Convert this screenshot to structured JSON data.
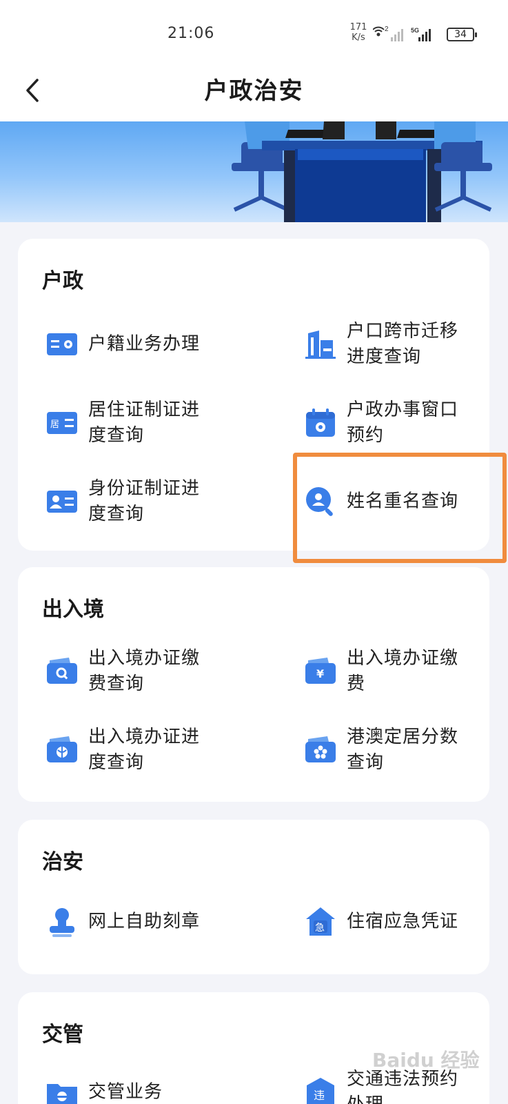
{
  "status_bar": {
    "time": "21:06",
    "net_speed_value": "171",
    "net_speed_unit": "K/s",
    "signal_label": "2",
    "network_type": "5G",
    "battery": "34"
  },
  "nav": {
    "back_icon": "chevron-left-icon",
    "title": "户政治安"
  },
  "sections": [
    {
      "title": "户政",
      "items": [
        {
          "label": "户籍业务办理",
          "icon": "id-card-icon"
        },
        {
          "label": "户口跨市迁移进度查询",
          "icon": "building-icon"
        },
        {
          "label": "居住证制证进度查询",
          "icon": "residence-card-icon"
        },
        {
          "label": "户政办事窗口预约",
          "icon": "calendar-icon"
        },
        {
          "label": "身份证制证进度查询",
          "icon": "identity-card-icon"
        },
        {
          "label": "姓名重名查询",
          "icon": "person-search-icon"
        }
      ]
    },
    {
      "title": "出入境",
      "items": [
        {
          "label": "出入境办证缴费查询",
          "icon": "wallet-search-icon"
        },
        {
          "label": "出入境办证缴费",
          "icon": "wallet-yuan-icon"
        },
        {
          "label": "出入境办证进度查询",
          "icon": "wallet-globe-icon"
        },
        {
          "label": "港澳定居分数查询",
          "icon": "wallet-flower-icon"
        }
      ]
    },
    {
      "title": "治安",
      "items": [
        {
          "label": "网上自助刻章",
          "icon": "stamp-icon"
        },
        {
          "label": "住宿应急凭证",
          "icon": "house-urgent-icon"
        }
      ]
    },
    {
      "title": "交管",
      "items": [
        {
          "label": "交管业务",
          "icon": "folder-police-icon"
        },
        {
          "label": "交通违法预约处理",
          "icon": "violation-icon"
        }
      ]
    }
  ],
  "highlight_color": "#f08c3e",
  "accent_color": "#3a7ee8",
  "watermark": "Baidu 经验"
}
